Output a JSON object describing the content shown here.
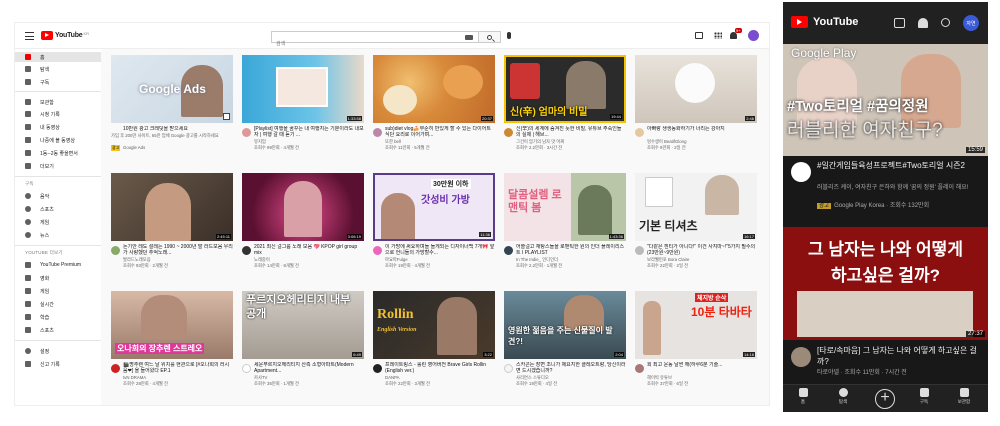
{
  "desktop": {
    "logo": "YouTube",
    "logo_sup": "KR",
    "search_placeholder": "검색",
    "notif_count": "9+",
    "sidebar": {
      "items": [
        {
          "label": "홈"
        },
        {
          "label": "탐색"
        },
        {
          "label": "구독"
        },
        {
          "label": "보관함"
        },
        {
          "label": "시청 기록"
        },
        {
          "label": "내 동영상"
        },
        {
          "label": "나중에 볼 동영상"
        },
        {
          "label": "1동--2동 좋을면서"
        },
        {
          "label": "더보기"
        }
      ],
      "section_subs": "구독",
      "subs": [
        {
          "label": "음악"
        },
        {
          "label": "스포츠"
        },
        {
          "label": "게임"
        },
        {
          "label": "뉴스"
        }
      ],
      "section_more": "YOUTUBE 더보기",
      "more": [
        {
          "label": "YouTube Premium"
        },
        {
          "label": "영화"
        },
        {
          "label": "게임"
        },
        {
          "label": "실시간"
        },
        {
          "label": "학습"
        },
        {
          "label": "스포츠"
        }
      ],
      "bottom": [
        {
          "label": "설정"
        },
        {
          "label": "신고 기록"
        }
      ]
    },
    "videos": [
      {
        "title": "10만원 광고 크레딧을 받으세요",
        "channel": "가입 후 200만 사이트, 65만 업체 Google 광고를 시작하세요",
        "stats": "",
        "ad_label": "광고",
        "ad_channel": "Google Ads",
        "duration": "",
        "overlay": "Google Ads"
      },
      {
        "title": "[Playlist] 여행을 꿈꾸는 내 여행지는 기분이라도 내보자 | 여행 갈 때 듣기 ...",
        "channel": "뮤지엄",
        "stats": "조회수 99만회 · 4개월 전",
        "duration": "1:33:58",
        "overlay": ""
      },
      {
        "title": "sub)diet vlog🍰무준히 만있게 할 수 있는 다이어트식단 요리로 이어가며...",
        "channel": "또한 bell",
        "stats": "조회수 11만회 · 5개월 전",
        "duration": "20:37",
        "overlay": ""
      },
      {
        "title": "신(辛)의 세계에 숨겨진 듯한 비밀, 유튜브 주숙인들의 실제 | 해브...",
        "channel": "그건이 암기의 남자 맛 어찌",
        "stats": "조회수 2.2만회 · 3시간 전",
        "duration": "19:44",
        "overlay": "신(辛) 엄마의 비밀"
      },
      {
        "title": "아빠랑 생생동화하기가 너리는 강아지",
        "channel": "멍수생이 BeatifGlong",
        "stats": "조회수 9만회 · 2일 전",
        "duration": "2:46",
        "overlay": ""
      },
      {
        "title": "돈기안 레도 설레는 1990 ~ 2000년 발 라드모음 우리가 사랑했던 추억노래...",
        "channel": "발라드노래모음",
        "stats": "조회수 93만회 · 2개월 전",
        "duration": "2:45:11",
        "overlay": ""
      },
      {
        "title": "2021 최신 걸그룹 노래 모음 💖 KPOP girl group mix",
        "channel": "노래중이",
        "stats": "조회수 14만회 · 8개월 전",
        "duration": "3:06:19",
        "overlay": ""
      },
      {
        "title": "이 가방에 써요하며들 들게되는 디자이너백 7개🎀 앞으로 언니들의 가방할수...",
        "channel": "마요마Fulge",
        "stats": "조회수 19만회 · 4개월 전",
        "duration": "11:36",
        "overlay": "갓성비 가방"
      },
      {
        "title": "어쓸걸고 재탕스들을 로맨틱한 원의 인더 플레이리스트 I PLAYLIST",
        "channel": "In The Indie_ 인디인더",
        "stats": "조회수 2.2만회 · 1개월 전",
        "duration": "1:43:36",
        "overlay": "달콤설렘 로맨틱 봄"
      },
      {
        "title": "\"다같은 흰티가 아니다!\" 이건 사지마~!\"5가지 필수의(23만원~9만원)",
        "channel": "보라웰먼포 Bora Claire",
        "stats": "조회수 22만회 · 2일 전",
        "duration": "16:17",
        "overlay": "기본 티셔츠"
      },
      {
        "title": "🎬명추렌 여느 날 위치를 현관으로 [#오나희의 러시움❤] 올 들어왔다 EP.1",
        "channel": "tvN DRAMA",
        "stats": "조회수 28만회 · 4개월 전",
        "duration": "",
        "overlay": "오나희의 장추렌 스트레오"
      },
      {
        "title": "세운푸르지오헤리티지 산측 소형아파트(Modern Apartment...",
        "channel": "카사TV",
        "stats": "조회수 35만회 · 1개월 전",
        "duration": "6:49",
        "overlay": "푸르지오헤리티지 내부공개"
      },
      {
        "title": "프레이트링스 - 롤린 영어버전 Brave Girls Rollin (English ver.)",
        "channel": "DANPA",
        "stats": "조회수 22만회 · 3개월 전",
        "duration": "3:22",
        "overlay": "Rollin"
      },
      {
        "title": "스카콘든 장면 조니가 제요지한 클레오트랑, 당신이라면 드시겠습니까?",
        "channel": "사리연스 스튜디오",
        "stats": "조회수 19만회 · 4일 전",
        "duration": "2:04",
        "overlay": "영원한 젊음을 주는 신물질이 발견?!"
      },
      {
        "title": "회 최고 운동 날썬 해(하루6분 기술...",
        "channel": "헤이빅 유튜브",
        "stats": "조회수 37만회 · 6일 전",
        "duration": "14:16",
        "overlay": "10분 타바타"
      }
    ]
  },
  "mobile": {
    "logo": "YouTube",
    "avatar": "자연",
    "video1": {
      "google_play": "Google Play",
      "overlay_1": "#Two토리얼 #꿈의정원",
      "overlay_2": "러블리한 여자친구?",
      "duration": "15:59",
      "title": "#일간게임들육성프로젝트#Two토리얼 시즌2",
      "desc": "러블리즈 케이, 여자친구 은하와 함께 '꿈의 정원' 플레이 해요!",
      "ad_label": "광고",
      "channel": "Google Play Korea · 조회수 132만회"
    },
    "video2": {
      "overlay_1": "그 남자는 나와 어떻게",
      "overlay_2": "하고싶은 걸까?",
      "duration": "27:37",
      "title": "[타로/속마음] 그 남자는 나와 어떻게 하고싶은 걸까?",
      "channel": "타로야넬 · 조회수 11만회 · 7시간 전"
    },
    "nav": [
      {
        "label": "홈"
      },
      {
        "label": "탐색"
      },
      {
        "label": ""
      },
      {
        "label": "구독"
      },
      {
        "label": "보관함"
      }
    ]
  },
  "colors": {
    "brand": "#ff0000",
    "mobile_bg": "#181818",
    "ad_badge": "#f6c31a"
  }
}
